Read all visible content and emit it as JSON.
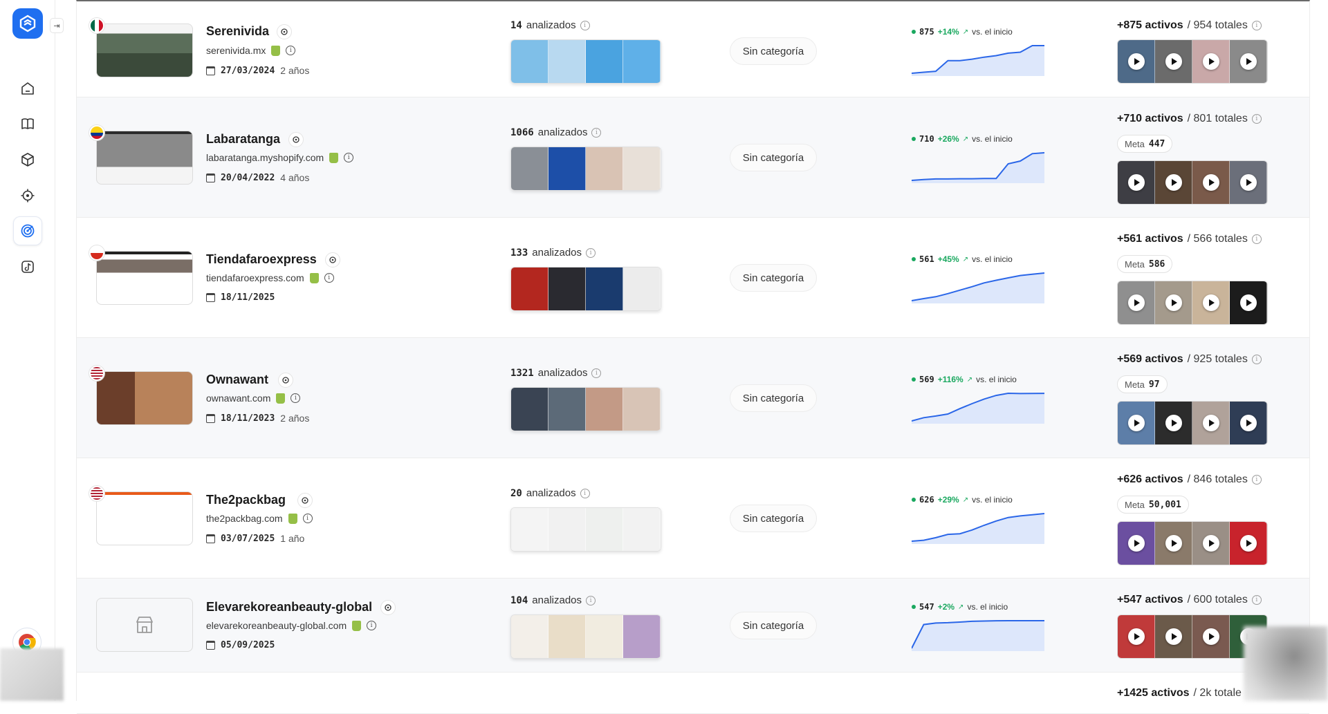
{
  "sidebar": {
    "collapse_glyph": "⇥",
    "nav_icons": [
      "home-icon",
      "book-icon",
      "cube-icon",
      "target-icon",
      "radar-icon",
      "tiktok-icon"
    ],
    "active_index": 4,
    "footer_icon": "chrome-icon"
  },
  "labels": {
    "analyzed": "analizados",
    "category": "Sin categoría",
    "vs_start": "vs. el inicio",
    "active_suffix": "activos",
    "meta": "Meta"
  },
  "stores": [
    {
      "name": "Serenivida",
      "domain": "serenivida.mx",
      "flag": "MX",
      "date": "27/03/2024",
      "age": "2 años",
      "analyzed": "14",
      "active_count": "875",
      "growth": "+14%",
      "ads_active": "+875",
      "ads_total": "/ 954 totales",
      "meta": "",
      "product_colors": [
        "#7fbfe8",
        "#b8d9f0",
        "#4aa3e0",
        "#5fb0e8"
      ],
      "video_colors": [
        "#4e6a88",
        "#6b6b6b",
        "#c9a8a8",
        "#8a8a8a"
      ],
      "sparkline": [
        820,
        822,
        824,
        845,
        845,
        848,
        852,
        855,
        860,
        862,
        875,
        875
      ]
    },
    {
      "name": "Labaratanga",
      "domain": "labaratanga.myshopify.com",
      "flag": "CO",
      "date": "20/04/2022",
      "age": "4 años",
      "analyzed": "1066",
      "active_count": "710",
      "growth": "+26%",
      "ads_active": "+710",
      "ads_total": "/ 801 totales",
      "meta": "447",
      "product_colors": [
        "#8a8f96",
        "#1d4fa8",
        "#d9c3b4",
        "#e8e0d8"
      ],
      "video_colors": [
        "#3e3e44",
        "#5a4636",
        "#7a5a4a",
        "#6b6f7a"
      ],
      "sparkline": [
        560,
        565,
        568,
        568,
        569,
        569,
        570,
        570,
        650,
        665,
        705,
        710
      ]
    },
    {
      "name": "Tiendafaroexpress",
      "domain": "tiendafaroexpress.com",
      "flag": "CL",
      "date": "18/11/2025",
      "age": "",
      "analyzed": "133",
      "active_count": "561",
      "growth": "+45%",
      "ads_active": "+561",
      "ads_total": "/ 566 totales",
      "meta": "586",
      "product_colors": [
        "#b3271f",
        "#2a2a30",
        "#1a3b6e",
        "#ececec"
      ],
      "video_colors": [
        "#8f8f8f",
        "#a49a8c",
        "#c9b49a",
        "#1c1c1c"
      ],
      "sparkline": [
        385,
        398,
        410,
        430,
        452,
        474,
        498,
        515,
        530,
        545,
        553,
        561
      ]
    },
    {
      "name": "Ownawant",
      "domain": "ownawant.com",
      "flag": "US",
      "date": "18/11/2023",
      "age": "2 años",
      "analyzed": "1321",
      "active_count": "569",
      "growth": "+116%",
      "ads_active": "+569",
      "ads_total": "/ 925 totales",
      "meta": "97",
      "product_colors": [
        "#3a4453",
        "#5c6a78",
        "#c39a86",
        "#d8c4b6"
      ],
      "video_colors": [
        "#5d7ea8",
        "#2c2c2c",
        "#b0a29a",
        "#2f3d55"
      ],
      "sparkline": [
        264,
        300,
        318,
        340,
        400,
        455,
        505,
        545,
        569,
        566,
        567,
        568
      ]
    },
    {
      "name": "The2packbag",
      "domain": "the2packbag.com",
      "flag": "US",
      "date": "03/07/2025",
      "age": "1 año",
      "analyzed": "20",
      "active_count": "626",
      "growth": "+29%",
      "ads_active": "+626",
      "ads_total": "/ 846 totales",
      "meta": "50,001",
      "product_colors": [
        "#f4f4f4",
        "#f1f1f1",
        "#eef0ee",
        "#f2f2f2"
      ],
      "video_colors": [
        "#6b4fa0",
        "#8a7a6a",
        "#9a8f86",
        "#c8232c"
      ],
      "sparkline": [
        485,
        490,
        503,
        520,
        523,
        542,
        566,
        588,
        606,
        614,
        620,
        626
      ]
    },
    {
      "name": "Elevarekoreanbeauty-global",
      "domain": "elevarekoreanbeauty-global.com",
      "flag": "",
      "date": "05/09/2025",
      "age": "",
      "analyzed": "104",
      "active_count": "547",
      "growth": "+2%",
      "ads_active": "+547",
      "ads_total": "/ 600 totales",
      "meta": "",
      "product_colors": [
        "#f3efe9",
        "#e9ddc8",
        "#f1ece0",
        "#b79ec9"
      ],
      "video_colors": [
        "#c03a3a",
        "#6b5a4a",
        "#7a5a50",
        "#2f5f3a"
      ],
      "sparkline": [
        0,
        470,
        500,
        507,
        520,
        535,
        540,
        545,
        547,
        547,
        547,
        547
      ]
    },
    {
      "name": "",
      "domain": "",
      "flag": "",
      "date": "",
      "age": "",
      "analyzed": "",
      "active_count": "",
      "growth": "",
      "ads_active": "+1425",
      "ads_total": "/ 2k totale",
      "meta": "",
      "product_colors": [],
      "video_colors": [],
      "sparkline": []
    }
  ]
}
